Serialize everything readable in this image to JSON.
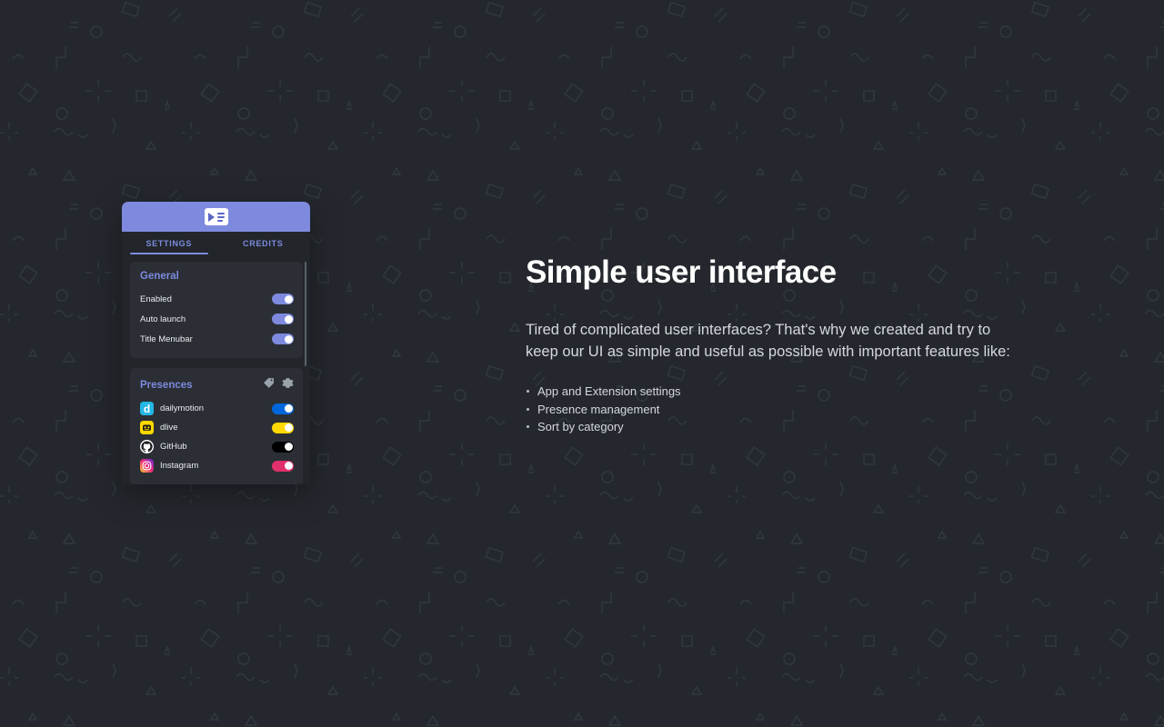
{
  "window": {
    "header_icon": "play-list-icon",
    "tabs": [
      {
        "label": "SETTINGS",
        "active": true,
        "name": "tab-settings"
      },
      {
        "label": "CREDITS",
        "active": false,
        "name": "tab-credits"
      }
    ],
    "accent_color": "#7d8ade",
    "header_color": "#7e8ade",
    "general": {
      "title": "General",
      "rows": [
        {
          "label": "Enabled",
          "on": true,
          "color": "#7d8ade"
        },
        {
          "label": "Auto launch",
          "on": true,
          "color": "#7d8ade"
        },
        {
          "label": "Title Menubar",
          "on": true,
          "color": "#7d8ade"
        }
      ]
    },
    "presences": {
      "title": "Presences",
      "icons": [
        {
          "name": "tag-icon"
        },
        {
          "name": "gear-icon"
        }
      ],
      "rows": [
        {
          "label": "dailymotion",
          "on": true,
          "color": "#0066dc",
          "icon": "dailymotion-icon",
          "icon_bg": "#23b7e5"
        },
        {
          "label": "dlive",
          "on": true,
          "color": "#ffd800",
          "icon": "dlive-icon",
          "icon_bg": "#ffd800"
        },
        {
          "label": "GitHub",
          "on": true,
          "color": "#000000",
          "icon": "github-icon",
          "icon_bg": "#ffffff"
        },
        {
          "label": "Instagram",
          "on": true,
          "color": "#e1306c",
          "icon": "instagram-icon",
          "icon_bg": "#c13584"
        }
      ]
    }
  },
  "content": {
    "heading": "Simple user interface",
    "paragraph": "Tired of complicated user interfaces? That's why we created and try to keep our UI as simple and useful as possible with important features like:",
    "features": [
      "App and Extension settings",
      "Presence management",
      "Sort by category"
    ]
  }
}
